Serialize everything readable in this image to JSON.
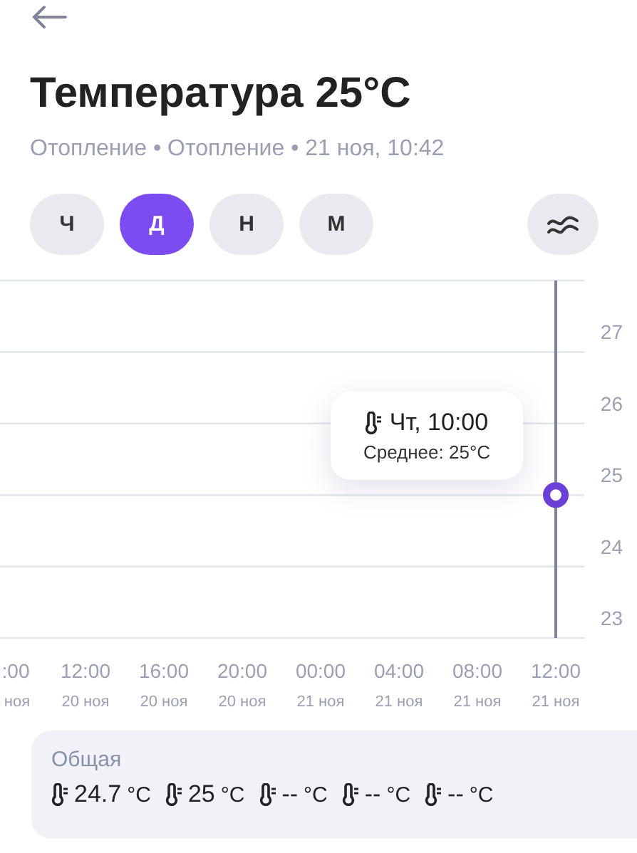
{
  "title": "Температура 25°C",
  "subtitle": "Отопление • Отопление • 21 ноя, 10:42",
  "periods": [
    {
      "label": "Ч",
      "selected": false
    },
    {
      "label": "Д",
      "selected": true
    },
    {
      "label": "Н",
      "selected": false
    },
    {
      "label": "М",
      "selected": false
    }
  ],
  "chart": {
    "chart_data": {
      "type": "line",
      "categories": [
        ":00",
        "12:00",
        "16:00",
        "20:00",
        "00:00",
        "04:00",
        "08:00",
        "12:00"
      ],
      "series": [
        {
          "color": "#6a3fd6",
          "marker": "circle",
          "values": [
            null,
            null,
            null,
            null,
            null,
            null,
            null,
            25
          ]
        }
      ],
      "ylim": [
        23,
        28
      ],
      "yticks": [
        23,
        24,
        25,
        26,
        27
      ],
      "grid": true
    },
    "dates": [
      "ноя",
      "20 ноя",
      "20 ноя",
      "20 ноя",
      "21 ноя",
      "21 ноя",
      "21 ноя",
      "21 ноя"
    ],
    "tooltip": {
      "time": "Чт, 10:00",
      "average": "Среднее: 25°C"
    }
  },
  "summary": {
    "title": "Общая",
    "readings": [
      {
        "value": "24.7",
        "unit": "°C"
      },
      {
        "value": "25",
        "unit": "°C"
      },
      {
        "value": "--",
        "unit": "°C"
      },
      {
        "value": "--",
        "unit": "°C"
      },
      {
        "value": "--",
        "unit": "°C"
      }
    ]
  }
}
